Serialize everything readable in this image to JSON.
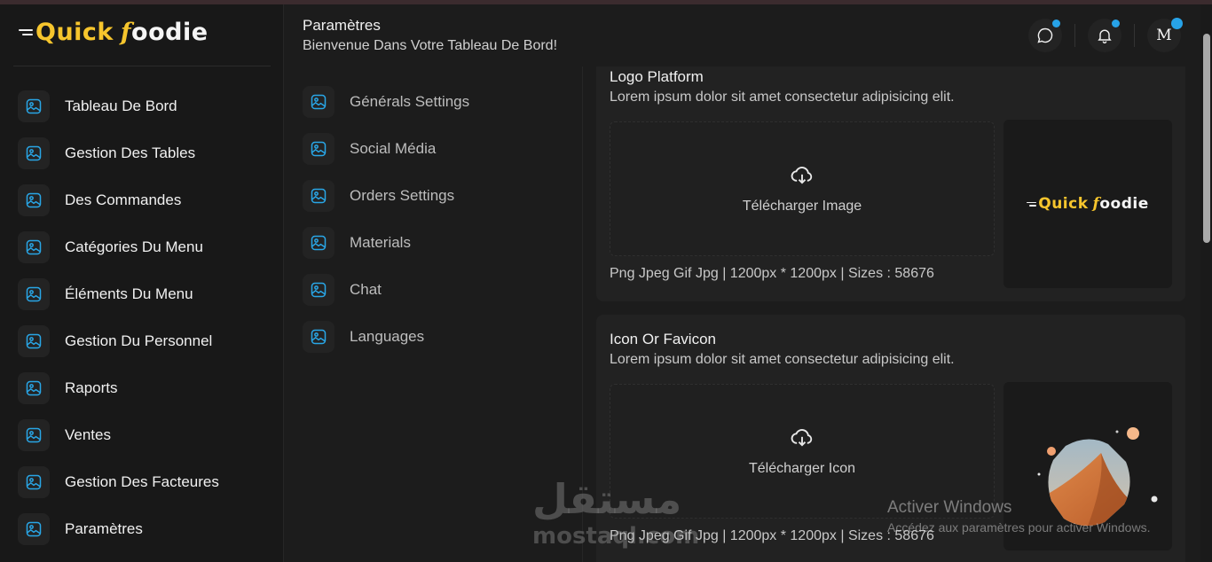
{
  "brand": {
    "part1": "Quick",
    "part2": "f",
    "part3": "oodie"
  },
  "sidebar": {
    "items": [
      {
        "label": "Tableau De Bord"
      },
      {
        "label": "Gestion Des Tables"
      },
      {
        "label": "Des Commandes"
      },
      {
        "label": "Catégories Du Menu"
      },
      {
        "label": "Éléments Du Menu"
      },
      {
        "label": "Gestion Du Personnel"
      },
      {
        "label": "Raports"
      },
      {
        "label": "Ventes"
      },
      {
        "label": "Gestion Des Facteures"
      },
      {
        "label": "Paramètres"
      }
    ]
  },
  "header": {
    "title": "Paramètres",
    "subtitle": "Bienvenue Dans Votre Tableau De Bord!",
    "avatar_letter": "M"
  },
  "submenu": {
    "items": [
      {
        "label": "Générals Settings"
      },
      {
        "label": "Social Média"
      },
      {
        "label": "Orders Settings"
      },
      {
        "label": "Materials"
      },
      {
        "label": "Chat"
      },
      {
        "label": "Languages"
      }
    ]
  },
  "logo_card": {
    "title": "Logo Platform",
    "description": "Lorem ipsum dolor sit amet consectetur adipisicing elit.",
    "upload_label": "Télécharger Image",
    "formats": "Png Jpeg Gif Jpg | 1200px * 1200px | Sizes : 58676"
  },
  "icon_card": {
    "title": "Icon Or Favicon",
    "description": "Lorem ipsum dolor sit amet consectetur adipisicing elit.",
    "upload_label": "Télécharger Icon",
    "formats": "Png Jpeg Gif Jpg | 1200px * 1200px | Sizes : 58676"
  },
  "watermark": {
    "arabic": "مستقل",
    "latin": "mostaql.com"
  },
  "windows_activation": {
    "title": "Activer Windows",
    "subtitle": "Accédez aux paramètres pour activer Windows."
  },
  "colors": {
    "accent": "#27a3e8",
    "brand_yellow": "#f6c52d",
    "background": "#1c1c1c"
  },
  "icons": {
    "nav": "image-icon",
    "upload": "cloud-download-icon",
    "chat": "chat-bubble-icon",
    "notifications": "bell-icon"
  }
}
